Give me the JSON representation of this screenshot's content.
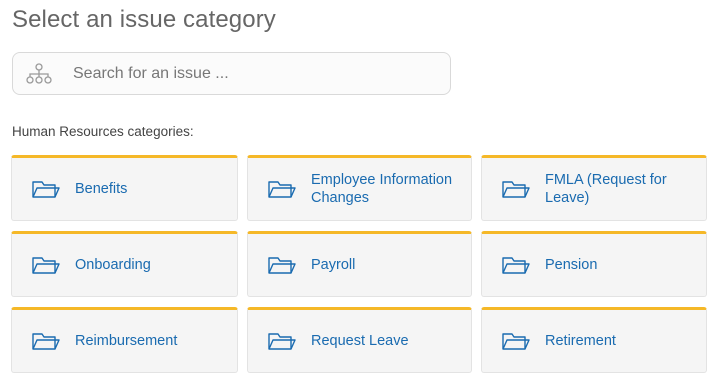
{
  "page": {
    "title": "Select an issue category",
    "section_label": "Human Resources categories:"
  },
  "search": {
    "placeholder": "Search for an issue ...",
    "value": "",
    "icon": "hierarchy-icon"
  },
  "categories": [
    {
      "label": "Benefits",
      "icon": "folder-icon"
    },
    {
      "label": "Employee Information Changes",
      "icon": "folder-icon"
    },
    {
      "label": "FMLA (Request for Leave)",
      "icon": "folder-icon"
    },
    {
      "label": "Onboarding",
      "icon": "folder-icon"
    },
    {
      "label": "Payroll",
      "icon": "folder-icon"
    },
    {
      "label": "Pension",
      "icon": "folder-icon"
    },
    {
      "label": "Reimbursement",
      "icon": "folder-icon"
    },
    {
      "label": "Request Leave",
      "icon": "folder-icon"
    },
    {
      "label": "Retirement",
      "icon": "folder-icon"
    }
  ],
  "colors": {
    "accent_top_border": "#f5b828",
    "link_blue": "#1a6bb0",
    "card_background": "#f5f5f5"
  }
}
